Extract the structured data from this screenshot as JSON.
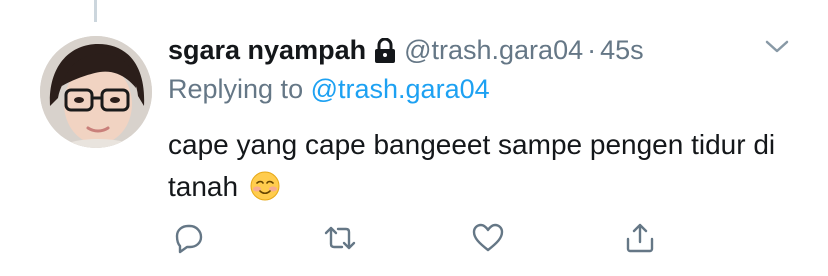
{
  "tweet": {
    "display_name": "sgara nyampah",
    "handle": "@trash.gara04",
    "separator": "·",
    "timestamp": "45s",
    "replying_prefix": "Replying to",
    "replying_to": "@trash.gara04",
    "text": "cape yang cape bangeeet sampe pengen tidur di tanah",
    "emoji": "☺️",
    "protected": true
  },
  "actions": {
    "reply": "reply-icon",
    "retweet": "retweet-icon",
    "like": "heart-icon",
    "share": "share-icon"
  },
  "colors": {
    "text": "#14171a",
    "secondary": "#657786",
    "link": "#1da1f2",
    "icon": "#657786",
    "thread_line": "#ccd6dd"
  }
}
